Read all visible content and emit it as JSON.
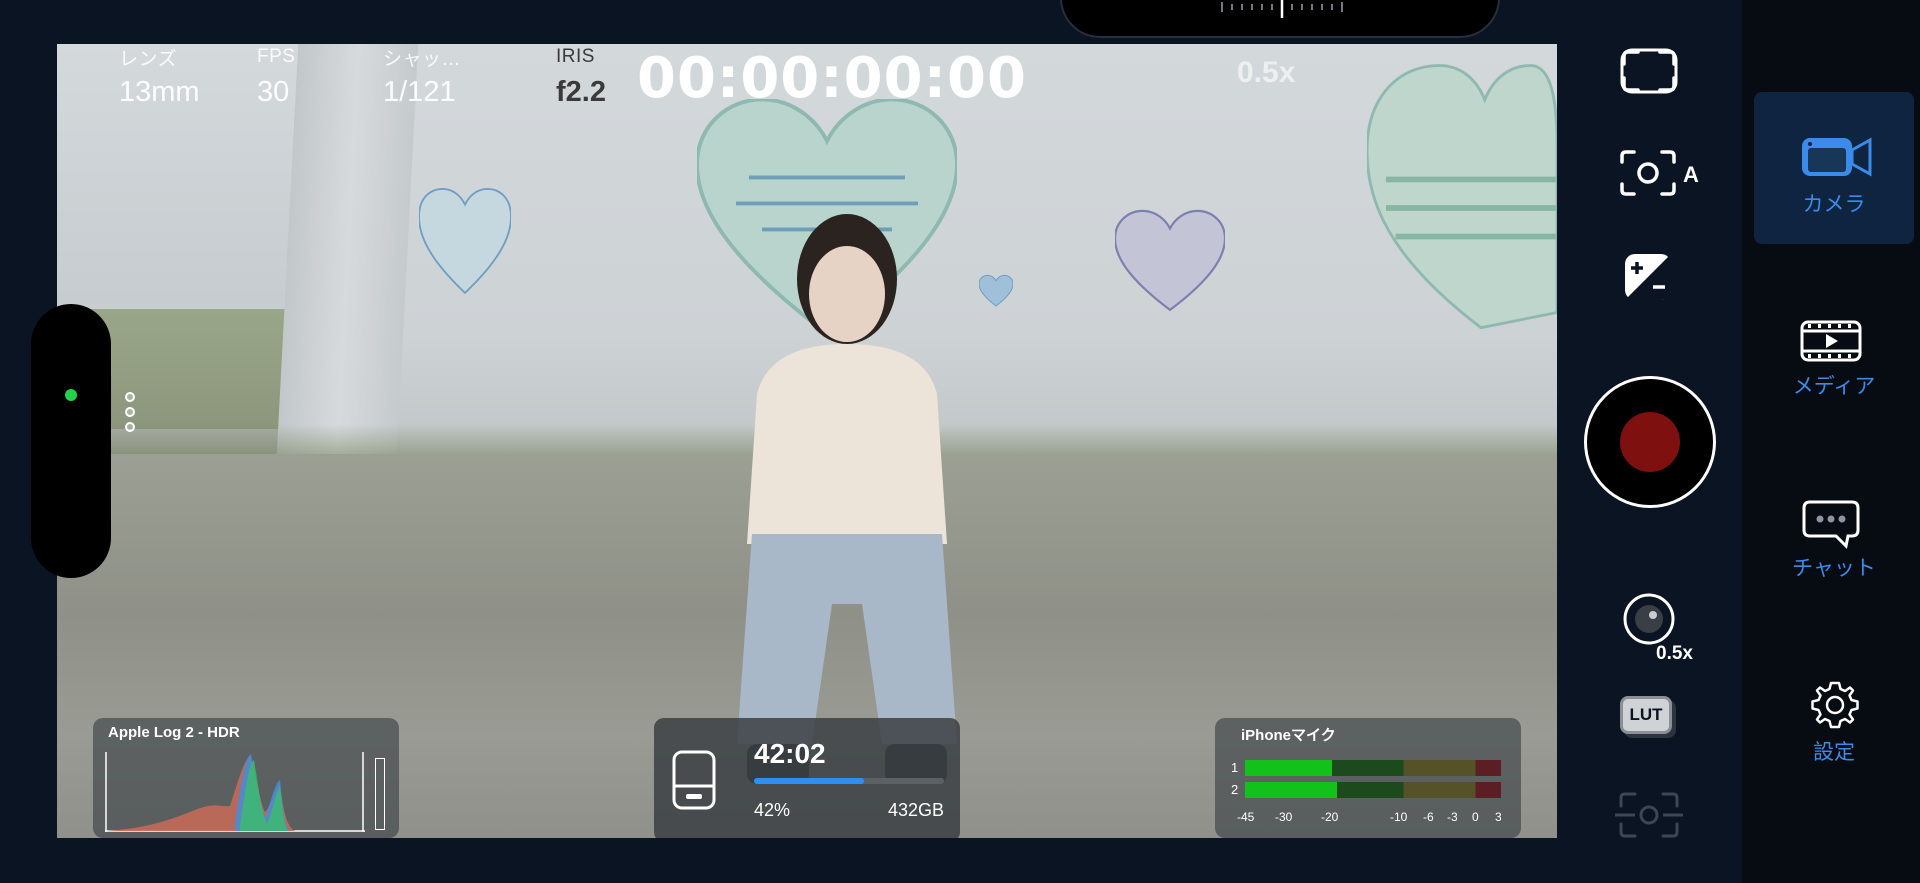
{
  "hud": {
    "lens_label": "レンズ",
    "lens_value": "13mm",
    "fps_label": "FPS",
    "fps_value": "30",
    "shutter_label": "シャッ…",
    "shutter_value": "1/121",
    "iris_label": "IRIS",
    "iris_value": "f2.2",
    "timecode": "00:00:00:00",
    "zoom": "0.5x"
  },
  "histogram_panel": {
    "title": "Apple Log 2 - HDR"
  },
  "storage_panel": {
    "remaining_time": "42:02",
    "percent": "42%",
    "capacity": "432GB",
    "fill_fraction": 0.58
  },
  "audio_panel": {
    "title": "iPhoneマイク",
    "channels": [
      "1",
      "2"
    ],
    "levels_fraction": [
      0.34,
      0.36
    ],
    "scale": [
      "-45",
      "-30",
      "-20",
      "-10",
      "-6",
      "-3",
      "0",
      "3"
    ]
  },
  "controls": {
    "focus_frame_icon": "focus-frame-icon",
    "auto_exposure_label": "A",
    "exposure_comp_icon": "exposure-compensation-icon",
    "lens_zoom_label": "0.5x",
    "lut_label": "LUT",
    "record_color": "#7f1010"
  },
  "sidebar": {
    "items": [
      {
        "label": "カメラ",
        "icon": "camera-icon",
        "active": true
      },
      {
        "label": "メディア",
        "icon": "media-icon",
        "active": false
      },
      {
        "label": "チャット",
        "icon": "chat-icon",
        "active": false
      },
      {
        "label": "設定",
        "icon": "settings-gear-icon",
        "active": false
      }
    ]
  },
  "colors": {
    "accent": "#3b8bea",
    "record_indicator": "#22d24a",
    "background": "#0b1422"
  }
}
